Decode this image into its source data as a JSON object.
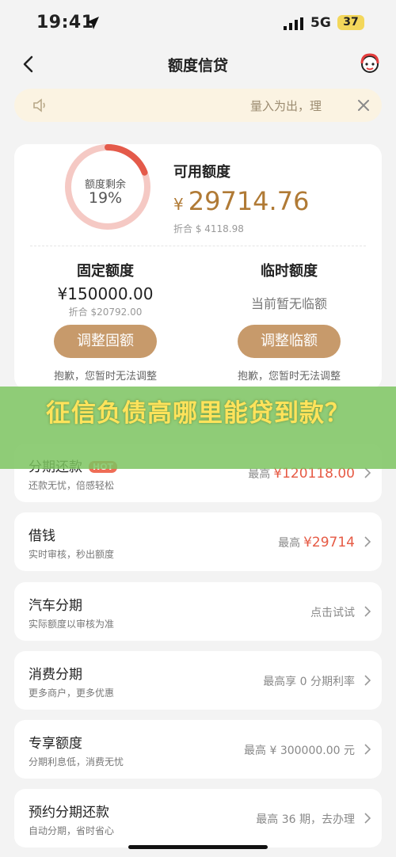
{
  "status": {
    "time": "19:41",
    "network": "5G",
    "battery": "37"
  },
  "header": {
    "title": "额度信贷"
  },
  "notice": {
    "text": "量入为出，理"
  },
  "credit": {
    "ring_label": "额度剩余",
    "ring_percent": "19%",
    "remaining_fraction": 0.19,
    "available_label": "可用额度",
    "currency_symbol": "¥",
    "available_amount": "29714.76",
    "available_converted": "折合 $ 4118.98",
    "fixed": {
      "title": "固定额度",
      "amount": "¥150000.00",
      "converted": "折合 $20792.00",
      "button": "调整固额",
      "note": "抱歉，您暂时无法调整"
    },
    "temp": {
      "title": "临时额度",
      "status": "当前暂无临额",
      "button": "调整临额",
      "note": "抱歉，您暂时无法调整"
    }
  },
  "overlay": {
    "title": "征信负债高哪里能贷到款？"
  },
  "products": [
    {
      "title": "分期还款",
      "badge": "HOT",
      "subtitle": "还款无忧，倍感轻松",
      "prefix": "最高",
      "value": "¥120118.00"
    },
    {
      "title": "借钱",
      "subtitle": "实时审核，秒出额度",
      "prefix": "最高",
      "value": "¥29714"
    },
    {
      "title": "汽车分期",
      "subtitle": "实际额度以审核为准",
      "prefix": "点击试试",
      "value": ""
    },
    {
      "title": "消费分期",
      "subtitle": "更多商户，更多优惠",
      "prefix": "最高享 0 分期利率",
      "value": ""
    },
    {
      "title": "专享额度",
      "subtitle": "分期利息低，消费无忧",
      "prefix": "最高 ¥ 300000.00 元",
      "value": ""
    },
    {
      "title": "预约分期还款",
      "subtitle": "自动分期，省时省心",
      "prefix": "最高 36 期，去办理",
      "value": ""
    }
  ],
  "colors": {
    "accent": "#c79a6b",
    "amount": "#b07a35",
    "red": "#e65a44",
    "ring_track": "#f5c9c4",
    "ring_fill": "#e45a4a",
    "overlay": "#7cc460",
    "overlay_text": "#ffe35b"
  },
  "icons": {
    "back": "chevron-left-icon",
    "service": "customer-service-icon",
    "speaker": "speaker-icon",
    "close": "close-icon",
    "chevron": "chevron-right-icon"
  }
}
